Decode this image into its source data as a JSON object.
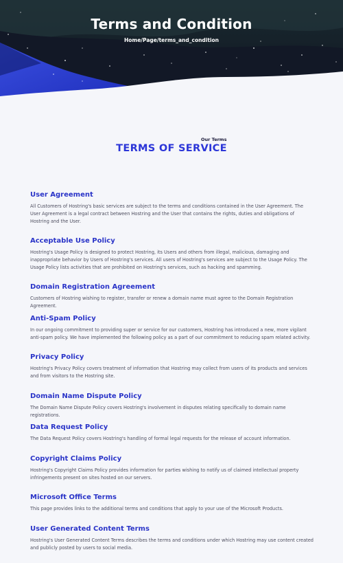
{
  "hero": {
    "title": "Terms and Condition",
    "breadcrumb": "Home/Page/terms_and_condition"
  },
  "section": {
    "eyebrow": "Our Terms",
    "title": "TERMS OF SERVICE"
  },
  "items": [
    {
      "title": "User Agreement",
      "text": "All Customers of Hostring's basic services are subject to the terms and conditions contained in the User Agreement. The User Agreement is a legal contract between Hostring and the User that contains the rights, duties and obligations of Hostring and the User."
    },
    {
      "title": "Acceptable Use Policy",
      "text": "Hostring's Usage Policy is designed to protect Hostring, its Users and others from illegal, malicious, damaging and inappropriate behavior by Users of Hostring's services. All users of Hostring's services are subject to the Usage Policy. The Usage Policy lists activities that are prohibited on Hostring's services, such as hacking and spamming."
    },
    {
      "title": "Domain Registration Agreement",
      "text": "Customers of Hostring wishing to register, transfer or renew a domain name must agree to the Domain Registration Agreement."
    },
    {
      "title": "Anti-Spam Policy",
      "text": "In our ongoing commitment to providing super or service for our customers, Hostring has introduced a new, more vigilant anti-spam policy. We have implemented the following policy as a part of our commitment to reducing spam related activity."
    },
    {
      "title": "Privacy Policy",
      "text": "Hostring's Privacy Policy covers treatment of information that Hostring may collect from users of its products and services and from visitors to the Hostring site."
    },
    {
      "title": "Domain Name Dispute Policy",
      "text": "The Domain Name Dispute Policy covers Hostring's involvement in disputes relating specifically to domain name registrations."
    },
    {
      "title": "Data Request Policy",
      "text": "The Data Request Policy covers Hostring's handling of formal legal requests for the release of account information."
    },
    {
      "title": "Copyright Claims Policy",
      "text": "Hostring's Copyright Claims Policy provides information for parties wishing to notify us of claimed intellectual property infringements present on sites hosted on our servers."
    },
    {
      "title": "Microsoft Office Terms",
      "text": "This page provides links to the additional terms and conditions that apply to your use of the Microsoft Products."
    },
    {
      "title": "User Generated Content Terms",
      "text": "Hostring's User Generated Content Terms describes the terms and conditions under which Hostring may use content created and publicly posted by users to social media."
    }
  ],
  "colors": {
    "accent": "#2c36d8",
    "hero_dark": "#141a22",
    "hero_blue": "#2336d0"
  }
}
